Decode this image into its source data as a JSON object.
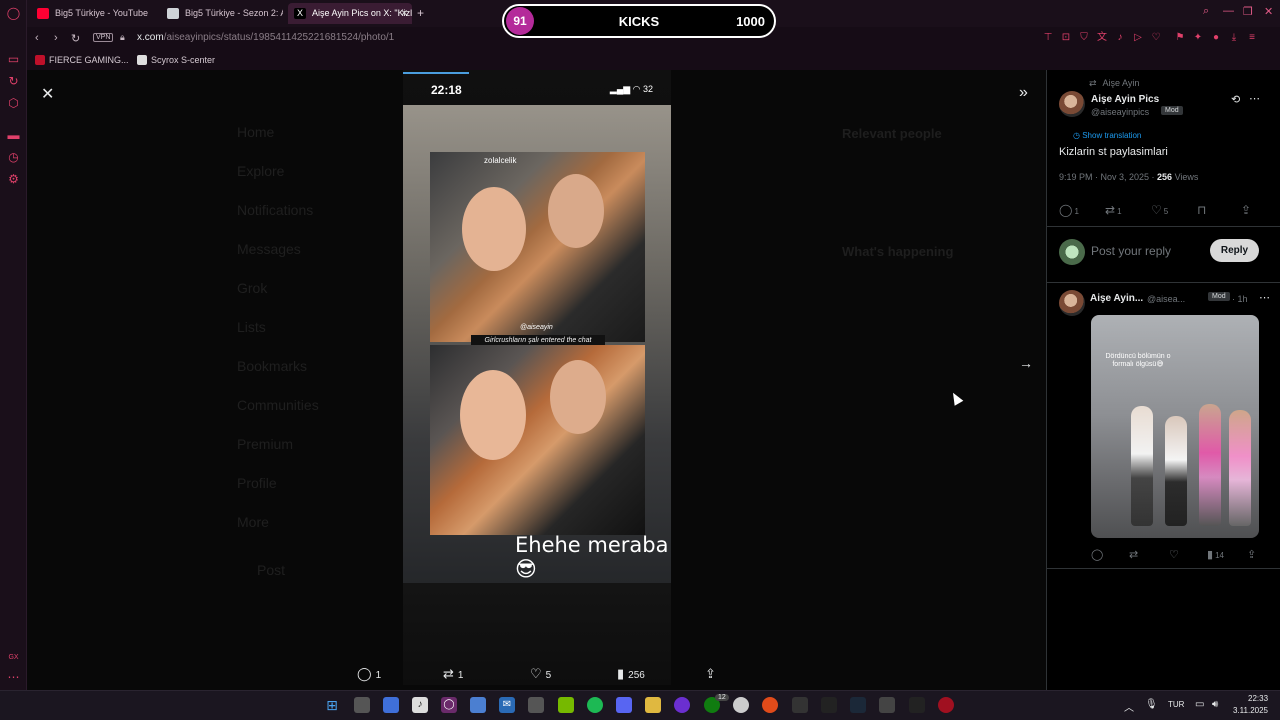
{
  "browser": {
    "tabs": [
      {
        "title": "Big5 Türkiye - YouTube",
        "color": "#ff0033"
      },
      {
        "title": "Big5 Türkiye - Sezon 2: A",
        "color": "#e7e9ea"
      },
      {
        "title": "Aişe Ayin Pics on X: \"Kizla",
        "color": "#e7e9ea"
      }
    ],
    "new_tab": "+",
    "vpn": "VPN",
    "url_host": "x.com",
    "url_path": "/aiseayinpics/status/1985411425221681524/photo/1",
    "bookmarks": [
      {
        "label": "FIERCE GAMING...",
        "color": "#c0102a"
      },
      {
        "label": "Scyrox S-center",
        "color": "#dddddd"
      }
    ]
  },
  "kicks": {
    "count": "91",
    "label": "KICKS",
    "goal": "1000"
  },
  "background": {
    "nav": [
      "Home",
      "Explore",
      "Notifications",
      "Messages",
      "Grok",
      "Lists",
      "Bookmarks",
      "Communities",
      "Premium",
      "Profile",
      "More"
    ],
    "post": "Post",
    "right": [
      "Relevant people",
      "What's happening"
    ]
  },
  "story": {
    "time": "22:18",
    "battery": "32",
    "top_user": "zolalcelik",
    "handle": "@aiseayin",
    "banner": "Girlcrushların şalı entered the chat",
    "caption": "Ehehe meraba😎"
  },
  "media_actions": {
    "replies": "1",
    "reposts": "1",
    "likes": "5",
    "views": "256"
  },
  "tweet": {
    "reposted_by": "Aişe Ayin",
    "author_name": "Aişe Ayin Pics",
    "author_handle": "@aiseayinpics",
    "badge": "Mod",
    "show_translation": "Show translation",
    "text": "Kizlarin st paylasimlari",
    "timestamp": "9:19 PM · Nov 3, 2025 · ",
    "views_count": "256",
    "views_label": " Views",
    "stats": {
      "replies": "1",
      "reposts": "1",
      "likes": "5"
    },
    "reply_placeholder": "Post your reply",
    "reply_button": "Reply"
  },
  "reply": {
    "name": "Aişe Ayin...",
    "handle": "@aisea...",
    "badge": "Mod",
    "time": "· 1h",
    "media_text": "Dördüncü bölümün o formalı ölgüsü😅",
    "views": "14"
  },
  "taskbar": {
    "lang": "TUR",
    "time": "22:33",
    "date": "3.11.2025",
    "badge": "12"
  },
  "colors": {
    "accent": "#e0406a",
    "link": "#1d9bf0",
    "kicks_circle": "#b42a9a"
  }
}
